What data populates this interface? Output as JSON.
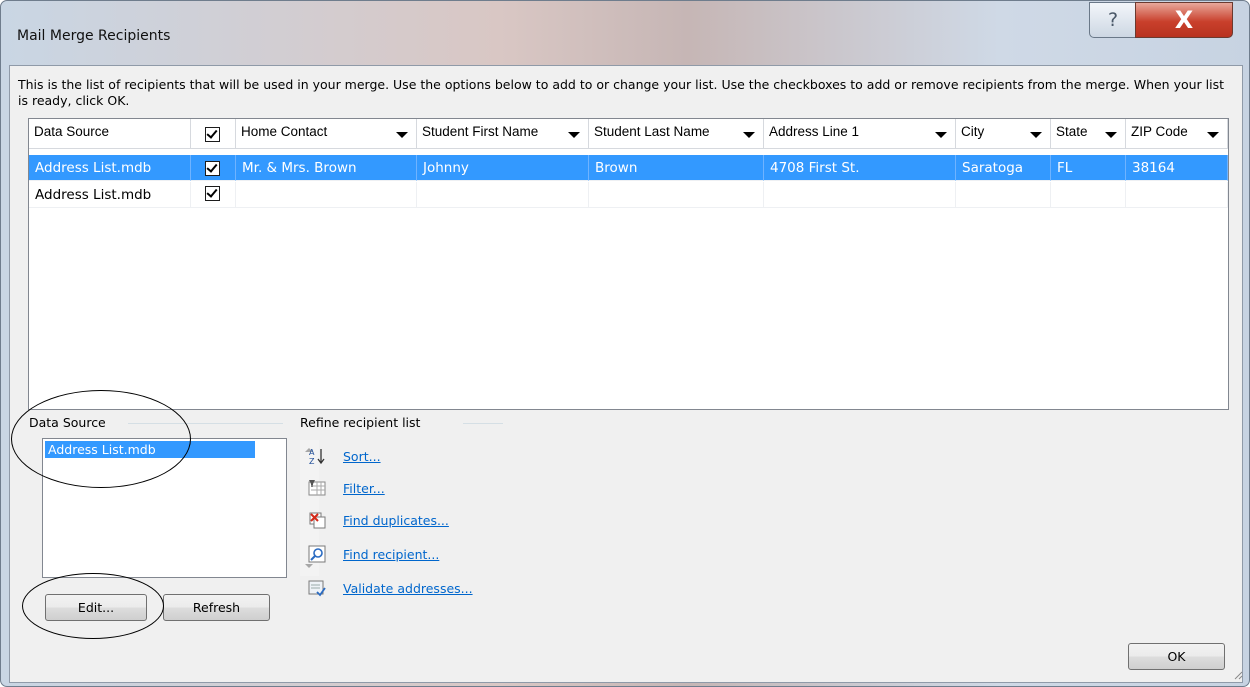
{
  "window": {
    "title": "Mail Merge Recipients",
    "help_glyph": "?",
    "close_glyph": "X"
  },
  "intro": "This is the list of recipients that will be used in your merge.  Use the options below to add to or change your list.  Use the checkboxes to add or remove recipients from the merge.  When your list is ready, click OK.",
  "grid": {
    "columns": [
      "Data Source",
      "",
      "Home Contact",
      "Student First Name",
      "Student Last Name",
      "Address Line 1",
      "City",
      "State",
      "ZIP Code"
    ],
    "rows": [
      {
        "source": "Address List.mdb",
        "checked": true,
        "home_contact": "Mr. & Mrs. Brown",
        "first": "Johnny",
        "last": "Brown",
        "address1": "4708 First St.",
        "city": "Saratoga",
        "state": "FL",
        "zip": "38164",
        "selected": true
      },
      {
        "source": "Address List.mdb",
        "checked": true,
        "home_contact": "",
        "first": "",
        "last": "",
        "address1": "",
        "city": "",
        "state": "",
        "zip": "",
        "selected": false
      }
    ]
  },
  "data_source": {
    "label": "Data Source",
    "items": [
      "Address List.mdb"
    ],
    "edit_label": "Edit...",
    "refresh_label": "Refresh"
  },
  "refine": {
    "label": "Refine recipient list",
    "items": [
      {
        "label": "Sort...",
        "icon": "sort-az-icon"
      },
      {
        "label": "Filter...",
        "icon": "filter-icon"
      },
      {
        "label": "Find duplicates...",
        "icon": "find-duplicates-icon"
      },
      {
        "label": "Find recipient...",
        "icon": "find-recipient-icon"
      },
      {
        "label": "Validate addresses...",
        "icon": "validate-addresses-icon"
      }
    ]
  },
  "ok_label": "OK",
  "colors": {
    "selection": "#3399ff",
    "link": "#0066cc"
  }
}
